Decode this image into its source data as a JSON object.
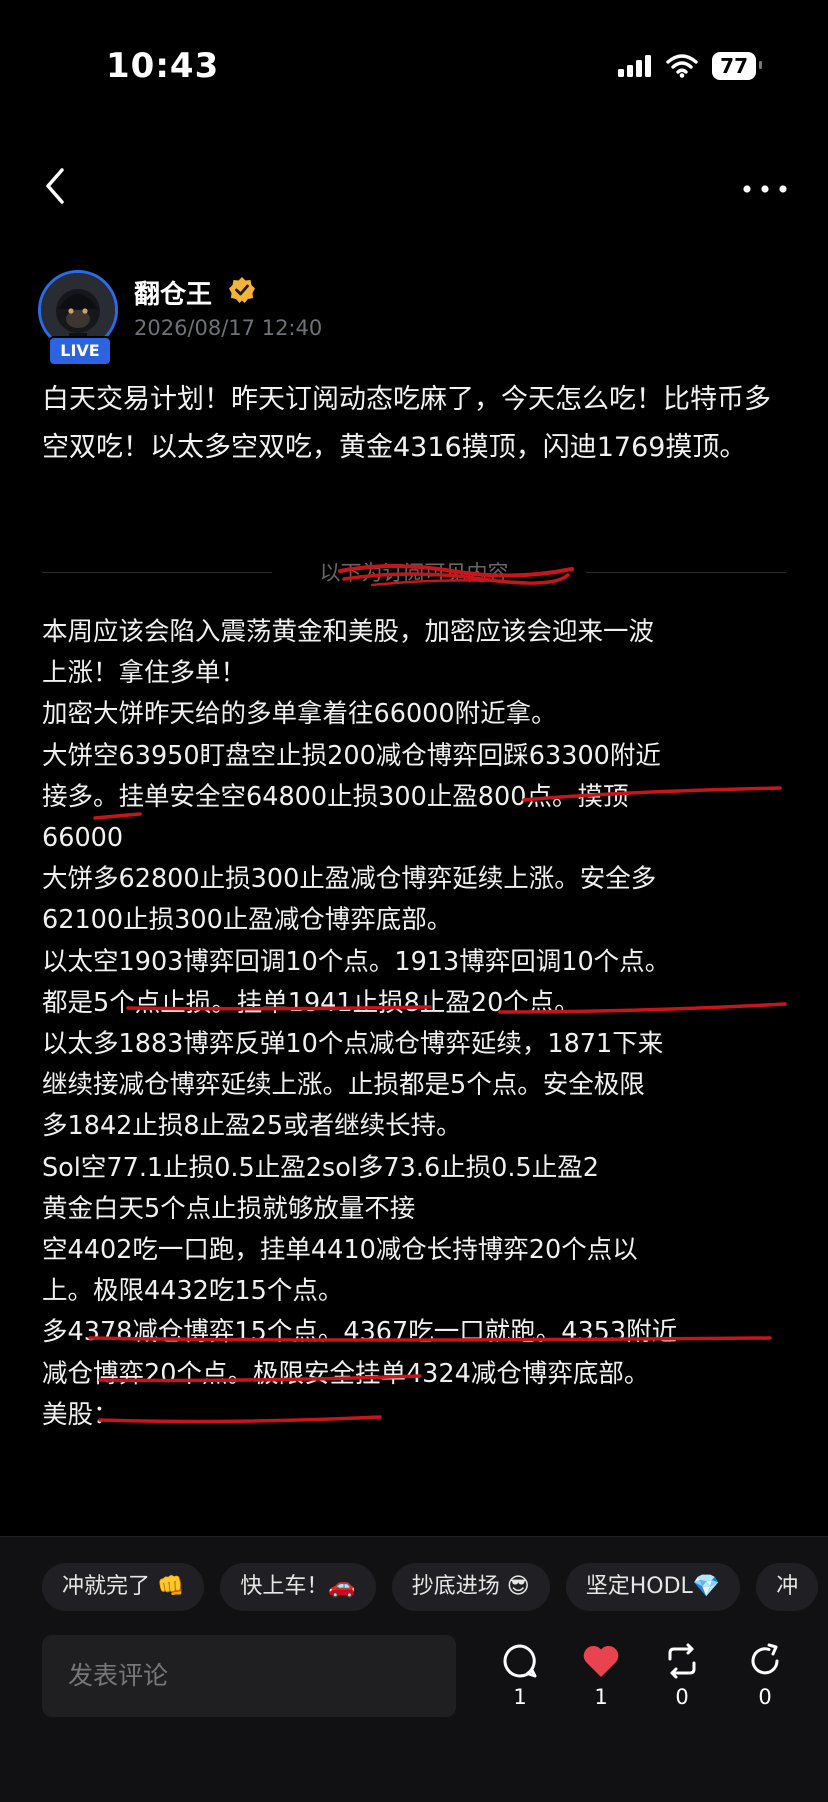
{
  "status_bar": {
    "time": "10:43",
    "battery": "77"
  },
  "author": {
    "name": "翻仓王",
    "badge": "LIVE",
    "date": "2026/08/17 12:40"
  },
  "headline": "白天交易计划！昨天订阅动态吃麻了，今天怎么吃！比特币多空双吃！以太多空双吃，黄金4316摸顶，闪迪1769摸顶。",
  "divider_label": "以下为订阅可见内容",
  "body_lines": [
    "本周应该会陷入震荡黄金和美股，加密应该会迎来一波",
    "上涨！拿住多单！",
    "加密大饼昨天给的多单拿着往66000附近拿。",
    "大饼空63950盯盘空止损200减仓博弈回踩63300附近",
    "接多。挂单安全空64800止损300止盈800点。摸顶",
    "66000",
    "大饼多62800止损300止盈减仓博弈延续上涨。安全多",
    "62100止损300止盈减仓博弈底部。",
    "以太空1903博弈回调10个点。1913博弈回调10个点。",
    "都是5个点止损。挂单1941止损8止盈20个点。",
    "以太多1883博弈反弹10个点减仓博弈延续，1871下来",
    "继续接减仓博弈延续上涨。止损都是5个点。安全极限",
    "多1842止损8止盈25或者继续长持。",
    "Sol空77.1止损0.5止盈2sol多73.6止损0.5止盈2",
    "黄金白天5个点止损就够放量不接",
    "空4402吃一口跑，挂单4410减仓长持博弈20个点以",
    "上。极限4432吃15个点。",
    "多4378减仓博弈15个点。4367吃一口就跑。4353附近",
    "减仓博弈20个点。极限安全挂单4324减仓博弈底部。",
    "美股："
  ],
  "quick_replies": [
    "冲就完了 👊",
    "快上车！🚗",
    "抄底进场 😎",
    "坚定HODL💎",
    "冲"
  ],
  "comment_placeholder": "发表评论",
  "actions": {
    "comment_count": "1",
    "like_count": "1",
    "repost_count": "0",
    "share_count": "0"
  },
  "colors": {
    "accent": "#2c63e0",
    "like": "#e8434f",
    "annotation": "#c8141b",
    "verified": "#f4b43a"
  }
}
